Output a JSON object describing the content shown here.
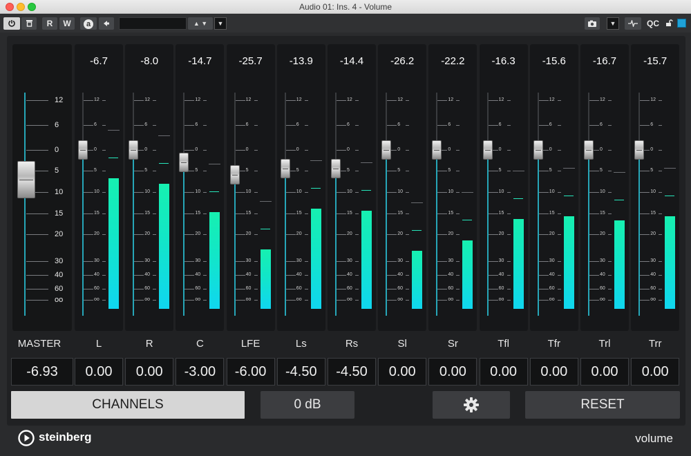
{
  "window": {
    "title": "Audio 01: Ins. 4 - Volume"
  },
  "toolbar": {
    "read_label": "R",
    "write_label": "W",
    "auto_label": "a",
    "qc_label": "QC"
  },
  "scale": {
    "labels": [
      "12",
      "6",
      "0",
      "5",
      "10",
      "15",
      "20",
      "30",
      "40",
      "60",
      "oo"
    ]
  },
  "master": {
    "name": "MASTER",
    "value": "-6.93",
    "fader_db": -6.93
  },
  "channels": [
    {
      "name": "L",
      "peak": "-6.7",
      "value": "0.00",
      "fader_db": 0,
      "meter_db": -6.7
    },
    {
      "name": "R",
      "peak": "-8.0",
      "value": "0.00",
      "fader_db": 0,
      "meter_db": -8.0
    },
    {
      "name": "C",
      "peak": "-14.7",
      "value": "-3.00",
      "fader_db": -3,
      "meter_db": -14.7
    },
    {
      "name": "LFE",
      "peak": "-25.7",
      "value": "-6.00",
      "fader_db": -6,
      "meter_db": -25.7
    },
    {
      "name": "Ls",
      "peak": "-13.9",
      "value": "-4.50",
      "fader_db": -4.5,
      "meter_db": -13.9
    },
    {
      "name": "Rs",
      "peak": "-14.4",
      "value": "-4.50",
      "fader_db": -4.5,
      "meter_db": -14.4
    },
    {
      "name": "Sl",
      "peak": "-26.2",
      "value": "0.00",
      "fader_db": 0,
      "meter_db": -26.2
    },
    {
      "name": "Sr",
      "peak": "-22.2",
      "value": "0.00",
      "fader_db": 0,
      "meter_db": -22.2
    },
    {
      "name": "Tfl",
      "peak": "-16.3",
      "value": "0.00",
      "fader_db": 0,
      "meter_db": -16.3
    },
    {
      "name": "Tfr",
      "peak": "-15.6",
      "value": "0.00",
      "fader_db": 0,
      "meter_db": -15.6
    },
    {
      "name": "Trl",
      "peak": "-16.7",
      "value": "0.00",
      "fader_db": 0,
      "meter_db": -16.7
    },
    {
      "name": "Trr",
      "peak": "-15.7",
      "value": "0.00",
      "fader_db": 0,
      "meter_db": -15.7
    }
  ],
  "buttons": {
    "channels": "CHANNELS",
    "zero_db": "0 dB",
    "reset": "RESET"
  },
  "footer": {
    "brand": "steinberg",
    "plugin_name": "volume"
  },
  "colors": {
    "meter_top": "#16f0b0",
    "meter_bottom": "#10d6f0",
    "accent": "#1fa2d8"
  }
}
